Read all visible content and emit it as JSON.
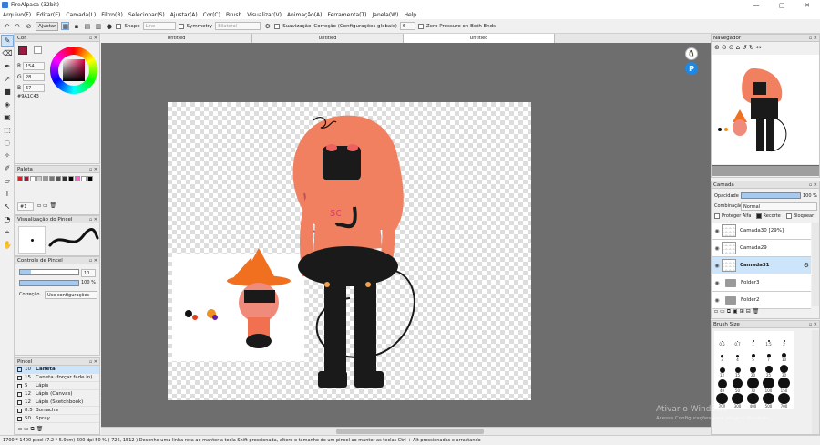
{
  "window": {
    "title": "FireAlpaca (32bit)",
    "minimize": "—",
    "maximize": "▢",
    "close": "✕"
  },
  "menu": [
    "Arquivo(F)",
    "Editar(E)",
    "Camada(L)",
    "Filtro(R)",
    "Selecionar(S)",
    "Ajustar(A)",
    "Cor(C)",
    "Brush",
    "Visualizar(V)",
    "Animação(A)",
    "Ferramenta(T)",
    "Janela(W)",
    "Help"
  ],
  "toolbar": {
    "adjust": "Ajustar",
    "shape": "Shape",
    "shape_value": "Line",
    "symmetry": "Symmetry",
    "symmetry_value": "Bilateral",
    "smooth": "Suavização",
    "correction": "Correção (Configurações globais)",
    "correction_value": "6",
    "zero_pressure": "Zero Pressure on Both Ends"
  },
  "tabs": [
    "Untitled",
    "Untitled",
    "Untitled"
  ],
  "color_panel": {
    "title": "Cor",
    "r_label": "R",
    "g_label": "G",
    "b_label": "B",
    "r": "154",
    "g": "28",
    "b": "67",
    "hex": "#9A1C43",
    "color": "#9a1c43"
  },
  "palette_panel": {
    "title": "Paleta",
    "selector": "#1",
    "colors": [
      "#e02020",
      "#9a1c43",
      "#ffffff",
      "#cccccc",
      "#999999",
      "#777777",
      "#555555",
      "#333333",
      "#000000",
      "#ff66cc",
      "#ffffff",
      "#000000"
    ]
  },
  "brush_preview": {
    "title": "Visualização do Pincel"
  },
  "brush_control": {
    "title": "Controle de Pincel",
    "size": "10",
    "opacity": "100 %",
    "correction_label": "Correção",
    "correction_value": "Use configurações"
  },
  "brush_list": {
    "title": "Pincel",
    "items": [
      {
        "size": "10",
        "name": "Caneta",
        "selected": true
      },
      {
        "size": "15",
        "name": "Caneta (forçar fade in)",
        "selected": false
      },
      {
        "size": "5",
        "name": "Lápis",
        "selected": false
      },
      {
        "size": "12",
        "name": "Lápis (Canvas)",
        "selected": false
      },
      {
        "size": "12",
        "name": "Lápis (Sketchbook)",
        "selected": false
      },
      {
        "size": "8.5",
        "name": "Borracha",
        "selected": false
      },
      {
        "size": "50",
        "name": "Spray",
        "selected": false
      }
    ]
  },
  "navigator": {
    "title": "Navegador"
  },
  "layers": {
    "title": "Camada",
    "opacity_label": "Opacidade",
    "opacity_value": "100 %",
    "blend_label": "Combinação",
    "blend_value": "Normal",
    "protect_alpha": "Proteger Alfa",
    "clipping": "Recorte",
    "lock": "Bloquear",
    "items": [
      {
        "name": "Camada30 [29%]",
        "type": "layer",
        "selected": false
      },
      {
        "name": "Camada29",
        "type": "layer",
        "selected": false
      },
      {
        "name": "Camada31",
        "type": "layer",
        "selected": true
      },
      {
        "name": "Folder3",
        "type": "folder",
        "selected": false
      },
      {
        "name": "Folder2",
        "type": "folder",
        "selected": false
      }
    ]
  },
  "brush_size": {
    "title": "Brush Size",
    "labels": [
      "0.5",
      "0.7",
      "1",
      "1.5",
      "2",
      "3",
      "4",
      "5",
      "7",
      "10",
      "12",
      "15",
      "20",
      "25",
      "30",
      "40",
      "50",
      "70",
      "100",
      "150",
      "200",
      "300",
      "400",
      "500",
      "700"
    ]
  },
  "status": "1700 * 1400 pixel  (7.2 * 5.9cm)  600 dpi  50 %  ( 726, 1512 )  Desenhe uma linha reta ao manter a tecla Shift pressionada, altere o tamanho de um pincel ao manter as teclas Ctrl + Alt pressionadas e arrastando",
  "watermark": {
    "line1": "Ativar o Windows",
    "line2": "Acesse Configurações para ativar o Windows."
  },
  "skin_color": "#f08060",
  "dark_color": "#1a1a1a"
}
